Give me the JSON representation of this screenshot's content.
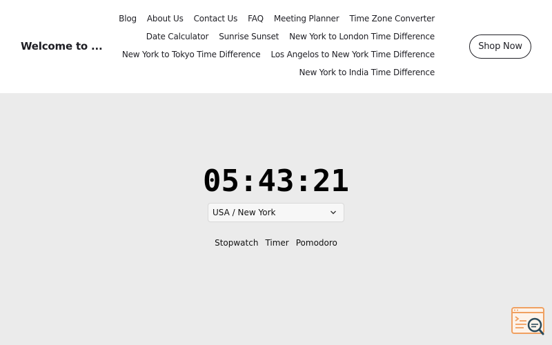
{
  "header": {
    "brand": "Welcome to ...",
    "nav_rows": [
      [
        "Blog",
        "About Us",
        "Contact Us",
        "FAQ",
        "Meeting Planner",
        "Time Zone Converter"
      ],
      [
        "Date Calculator",
        "Sunrise Sunset",
        "New York to London Time Difference"
      ],
      [
        "New York to Tokyo Time Difference",
        "Los Angelos to New York Time Difference"
      ],
      [
        "New York to India Time Difference"
      ]
    ],
    "shop_button": "Shop Now"
  },
  "main": {
    "time": "05:43:21",
    "timezone_selected": "USA / New York",
    "modes": [
      "Stopwatch",
      "Timer",
      "Pomodoro"
    ]
  },
  "colors": {
    "background": "#ebebeb",
    "header_bg": "#ffffff",
    "text": "#1e1e24",
    "widget_accent": "#f0a060",
    "widget_dark": "#2a4a5a"
  },
  "icons": {
    "dropdown": "chevron-down-icon",
    "widget": "search-chat-widget-icon"
  }
}
